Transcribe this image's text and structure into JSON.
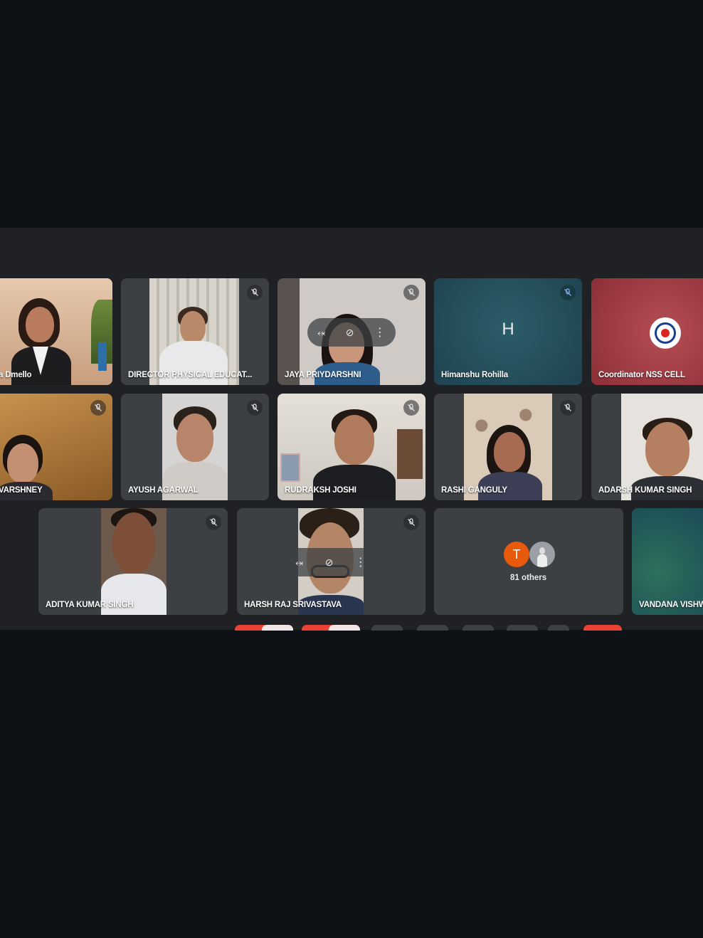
{
  "participants": [
    {
      "name": "a Dmello",
      "muted": false
    },
    {
      "name": "DIRECTOR PHYSICAL EDUCAT...",
      "muted": true
    },
    {
      "name": "JAYA PRIYDARSHNI",
      "muted": true
    },
    {
      "name": "Himanshu Rohilla",
      "muted": true,
      "avatar_letter": "H"
    },
    {
      "name": "Coordinator NSS CELL",
      "muted": false
    },
    {
      "name": "VARSHNEY",
      "muted": true
    },
    {
      "name": "AYUSH AGARWAL",
      "muted": true
    },
    {
      "name": "RUDRAKSH JOSHI",
      "muted": true
    },
    {
      "name": "RASHI GANGULY",
      "muted": true
    },
    {
      "name": "ADARSH KUMAR SINGH",
      "muted": false
    },
    {
      "name": "ADITYA KUMAR SINGH",
      "muted": true
    },
    {
      "name": "HARSH RAJ SRIVASTAVA",
      "muted": true
    },
    {
      "name": "VANDANA VISHW",
      "muted": false
    }
  ],
  "others_tile": {
    "avatar_letter": "T",
    "label": "81 others"
  },
  "colors": {
    "page_bg": "#0e1116",
    "meet_bg": "#202124",
    "tile_bg": "#3c4043",
    "himanshu_tile": "#1f4b57",
    "nss_tile": "#a23a44",
    "vandana_tile": "#1d5a5c",
    "avatar_t": "#e8590c",
    "leave_red": "#ea4335"
  },
  "icons": [
    "mic-off-icon",
    "pin-icon",
    "more-vert-icon"
  ]
}
